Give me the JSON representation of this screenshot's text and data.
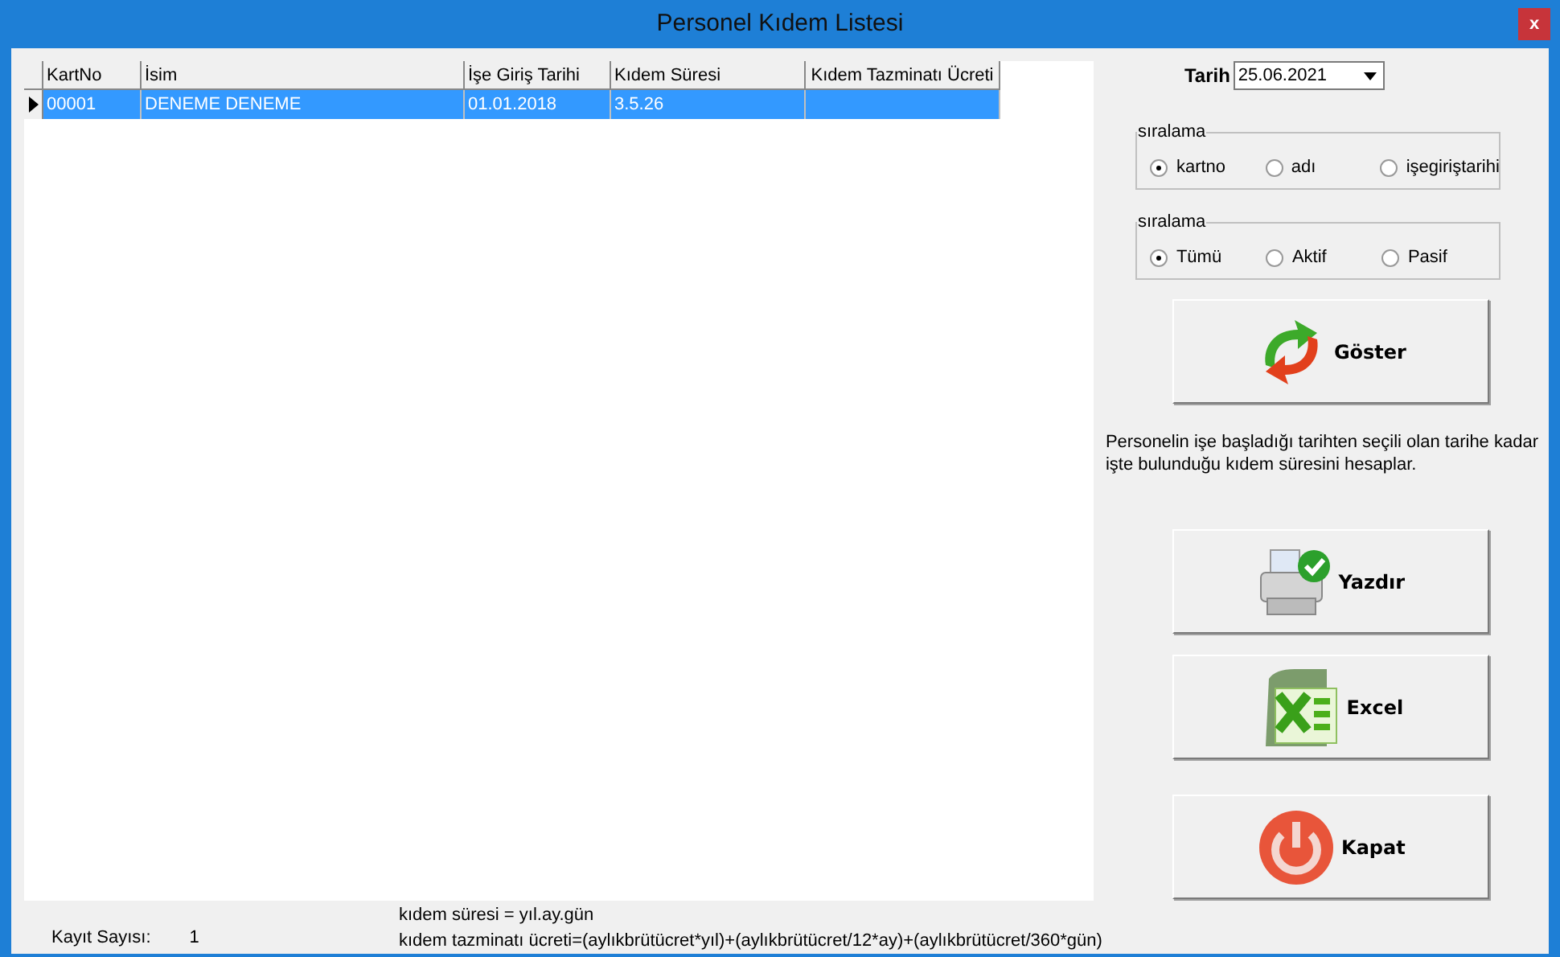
{
  "window": {
    "title": "Personel Kıdem Listesi",
    "close": "x"
  },
  "table": {
    "columns": [
      "KartNo",
      "İsim",
      "İşe Giriş Tarihi",
      "Kıdem Süresi",
      "Kıdem Tazminatı Ücreti"
    ],
    "rows": [
      {
        "selected": true,
        "cells": [
          "00001",
          "DENEME DENEME",
          "01.01.2018",
          "3.5.26",
          ""
        ]
      }
    ]
  },
  "date": {
    "label": "Tarih",
    "value": "25.06.2021"
  },
  "groups": [
    {
      "title": "sıralama",
      "options": [
        {
          "label": "kartno",
          "selected": true
        },
        {
          "label": "adı",
          "selected": false
        },
        {
          "label": "işegiriştarihi",
          "selected": false
        }
      ]
    },
    {
      "title": "sıralama",
      "options": [
        {
          "label": "Tümü",
          "selected": true
        },
        {
          "label": "Aktif",
          "selected": false
        },
        {
          "label": "Pasif",
          "selected": false
        }
      ]
    }
  ],
  "show_button": {
    "label": "Göster",
    "kind": "refresh"
  },
  "description": "Personelin işe başladığı tarihten seçili olan tarihe kadar işte bulunduğu kıdem süresini hesaplar.",
  "buttons": [
    {
      "label": "Yazdır",
      "kind": "printer"
    },
    {
      "label": "Excel",
      "kind": "excel"
    },
    {
      "label": "Kapat",
      "kind": "power"
    }
  ],
  "record_count": {
    "label": "Kayıt Sayısı:",
    "value": "1"
  },
  "formulas": [
    "kıdem süresi = yıl.ay.gün",
    "kıdem tazminatı ücreti=(aylıkbrütücret*yıl)+(aylıkbrütücret/12*ay)+(aylıkbrütücret/360*gün)"
  ]
}
